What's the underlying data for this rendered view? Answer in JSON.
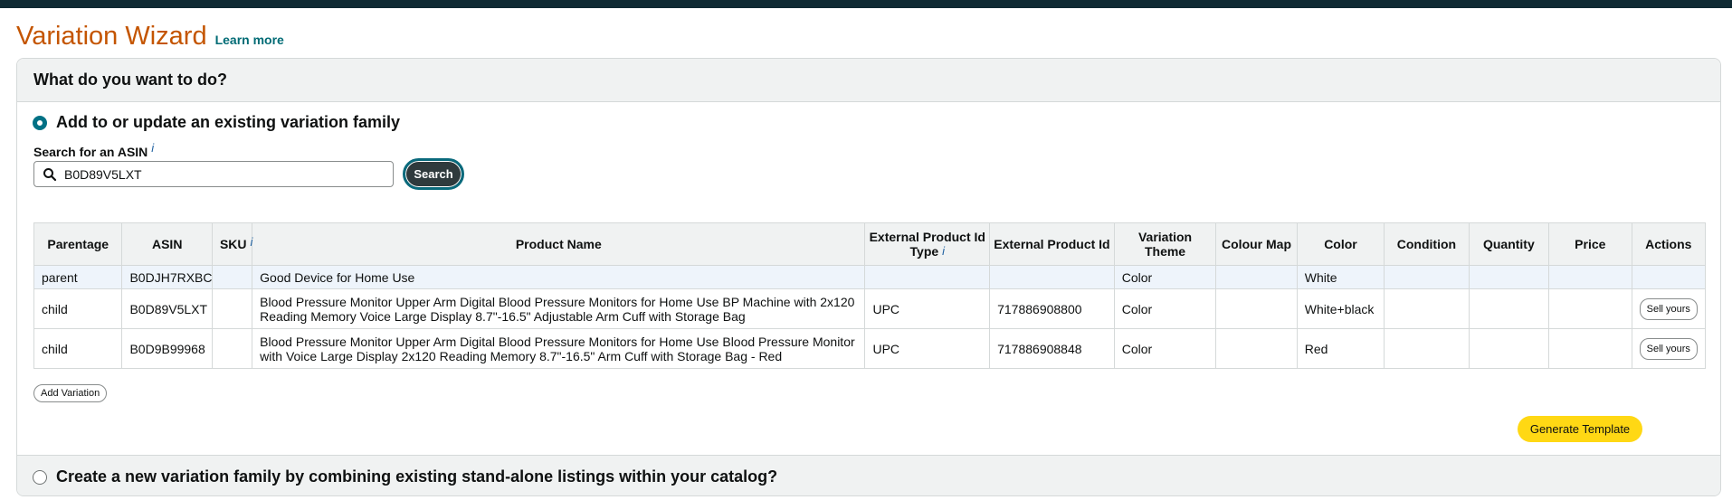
{
  "header": {
    "title": "Variation Wizard",
    "learn_more": "Learn more",
    "accent_color": "#c45500",
    "link_color": "#006b75"
  },
  "panel": {
    "question": "What do you want to do?",
    "option_existing": {
      "label": "Add to or update an existing variation family",
      "selected": true
    },
    "option_new": {
      "label": "Create a new variation family by combining existing stand-alone listings within your catalog?",
      "selected": false
    }
  },
  "search": {
    "label": "Search for an ASIN",
    "info_icon": "i",
    "value": "B0D89V5LXT",
    "button_label": "Search"
  },
  "table": {
    "columns": [
      "Parentage",
      "ASIN",
      "SKU",
      "Product Name",
      "External Product Id Type",
      "External Product Id",
      "Variation Theme",
      "Colour Map",
      "Color",
      "Condition",
      "Quantity",
      "Price",
      "Actions"
    ],
    "rows": [
      {
        "parentage": "parent",
        "asin": "B0DJH7RXBC",
        "sku": "",
        "product_name": "Good Device for Home Use",
        "ext_id_type": "",
        "ext_id": "",
        "variation_theme": "Color",
        "colour_map": "",
        "color": "White",
        "condition": "",
        "quantity": "",
        "price": "",
        "action": ""
      },
      {
        "parentage": "child",
        "asin": "B0D89V5LXT",
        "sku": "",
        "product_name": "Blood Pressure Monitor Upper Arm Digital Blood Pressure Monitors for Home Use BP Machine with 2x120 Reading Memory Voice Large Display 8.7\"-16.5\" Adjustable Arm Cuff with Storage Bag",
        "ext_id_type": "UPC",
        "ext_id": "717886908800",
        "variation_theme": "Color",
        "colour_map": "",
        "color": "White+black",
        "condition": "",
        "quantity": "",
        "price": "",
        "action": "Sell yours"
      },
      {
        "parentage": "child",
        "asin": "B0D9B99968",
        "sku": "",
        "product_name": "Blood Pressure Monitor Upper Arm Digital Blood Pressure Monitors for Home Use Blood Pressure Monitor with Voice Large Display 2x120 Reading Memory 8.7\"-16.5\" Arm Cuff with Storage Bag - Red",
        "ext_id_type": "UPC",
        "ext_id": "717886908848",
        "variation_theme": "Color",
        "colour_map": "",
        "color": "Red",
        "condition": "",
        "quantity": "",
        "price": "",
        "action": "Sell yours"
      }
    ]
  },
  "buttons": {
    "add_variation": "Add Variation",
    "generate_template": "Generate Template",
    "generate_color": "#ffd814"
  }
}
